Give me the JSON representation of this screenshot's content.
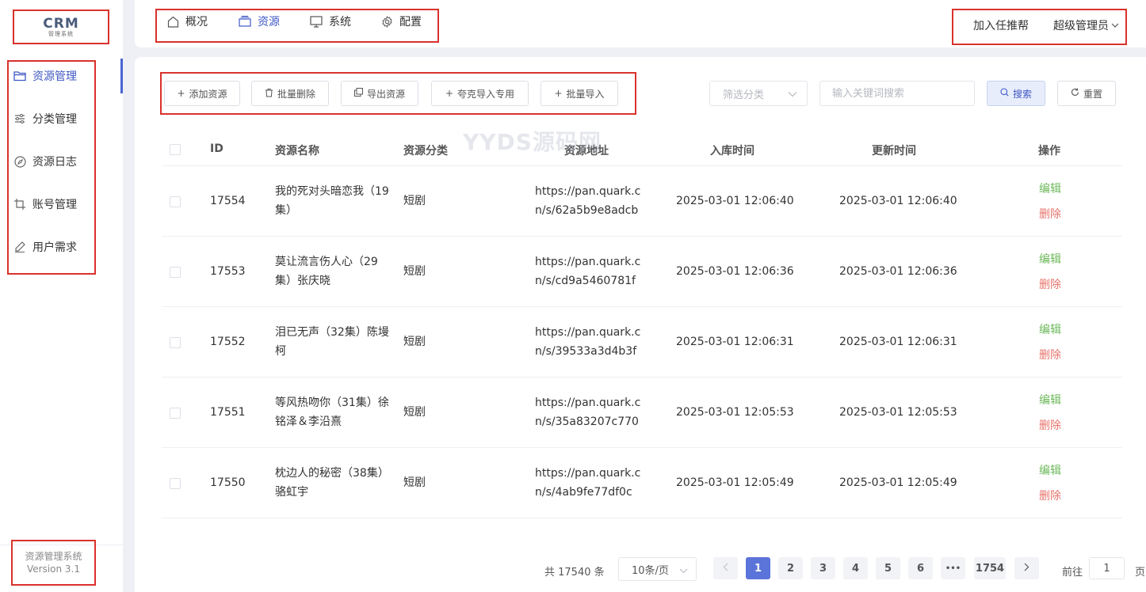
{
  "logo": {
    "main": "CRM",
    "sub": "管理系统"
  },
  "sidebar": {
    "items": [
      {
        "label": "资源管理",
        "icon": "folder-icon",
        "active": true
      },
      {
        "label": "分类管理",
        "icon": "sliders-icon",
        "active": false
      },
      {
        "label": "资源日志",
        "icon": "compass-icon",
        "active": false
      },
      {
        "label": "账号管理",
        "icon": "crop-icon",
        "active": false
      },
      {
        "label": "用户需求",
        "icon": "pen-icon",
        "active": false
      }
    ],
    "footer_title": "资源管理系统",
    "footer_version": "Version 3.1"
  },
  "topnav": {
    "items": [
      {
        "label": "概况",
        "icon": "home-icon"
      },
      {
        "label": "资源",
        "icon": "stack-icon",
        "active": true
      },
      {
        "label": "系统",
        "icon": "monitor-icon"
      },
      {
        "label": "配置",
        "icon": "gear-icon"
      }
    ],
    "join_label": "加入任推帮",
    "user_label": "超级管理员"
  },
  "toolbar": {
    "add": "添加资源",
    "batch_delete": "批量删除",
    "export": "导出资源",
    "quark_import": "夸克导入专用",
    "batch_import": "批量导入",
    "filter_placeholder": "筛选分类",
    "search_placeholder": "输入关键词搜索",
    "search": "搜索",
    "reset": "重置"
  },
  "watermark": "YYDS源码网",
  "table": {
    "headers": {
      "id": "ID",
      "name": "资源名称",
      "category": "资源分类",
      "url": "资源地址",
      "created": "入库时间",
      "updated": "更新时间",
      "actions": "操作"
    },
    "edit_label": "编辑",
    "delete_label": "删除",
    "rows": [
      {
        "id": "17554",
        "name": "我的死对头暗恋我（19集）",
        "category": "短剧",
        "url": "https://pan.quark.cn/s/62a5b9e8adcb",
        "created": "2025-03-01 12:06:40",
        "updated": "2025-03-01 12:06:40"
      },
      {
        "id": "17553",
        "name": "莫让流言伤人心（29集）张庆晓",
        "category": "短剧",
        "url": "https://pan.quark.cn/s/cd9a5460781f",
        "created": "2025-03-01 12:06:36",
        "updated": "2025-03-01 12:06:36"
      },
      {
        "id": "17552",
        "name": "泪已无声（32集）陈墁柯",
        "category": "短剧",
        "url": "https://pan.quark.cn/s/39533a3d4b3f",
        "created": "2025-03-01 12:06:31",
        "updated": "2025-03-01 12:06:31"
      },
      {
        "id": "17551",
        "name": "等风热吻你（31集）徐铭泽＆李沿熹",
        "category": "短剧",
        "url": "https://pan.quark.cn/s/35a83207c770",
        "created": "2025-03-01 12:05:53",
        "updated": "2025-03-01 12:05:53"
      },
      {
        "id": "17550",
        "name": "枕边人的秘密（38集）骆虹宇",
        "category": "短剧",
        "url": "https://pan.quark.cn/s/4ab9fe77df0c",
        "created": "2025-03-01 12:05:49",
        "updated": "2025-03-01 12:05:49"
      }
    ]
  },
  "pagination": {
    "total": "共 17540 条",
    "page_size": "10条/页",
    "pages": [
      "1",
      "2",
      "3",
      "4",
      "5",
      "6",
      "•••",
      "1754"
    ],
    "current": "1",
    "goto_label": "前往",
    "goto_value": "1",
    "page_suffix": "页"
  },
  "colors": {
    "accent": "#4964d0",
    "edit": "#6cb85a",
    "delete": "#e8736b",
    "highlight_box": "#d9322c"
  }
}
